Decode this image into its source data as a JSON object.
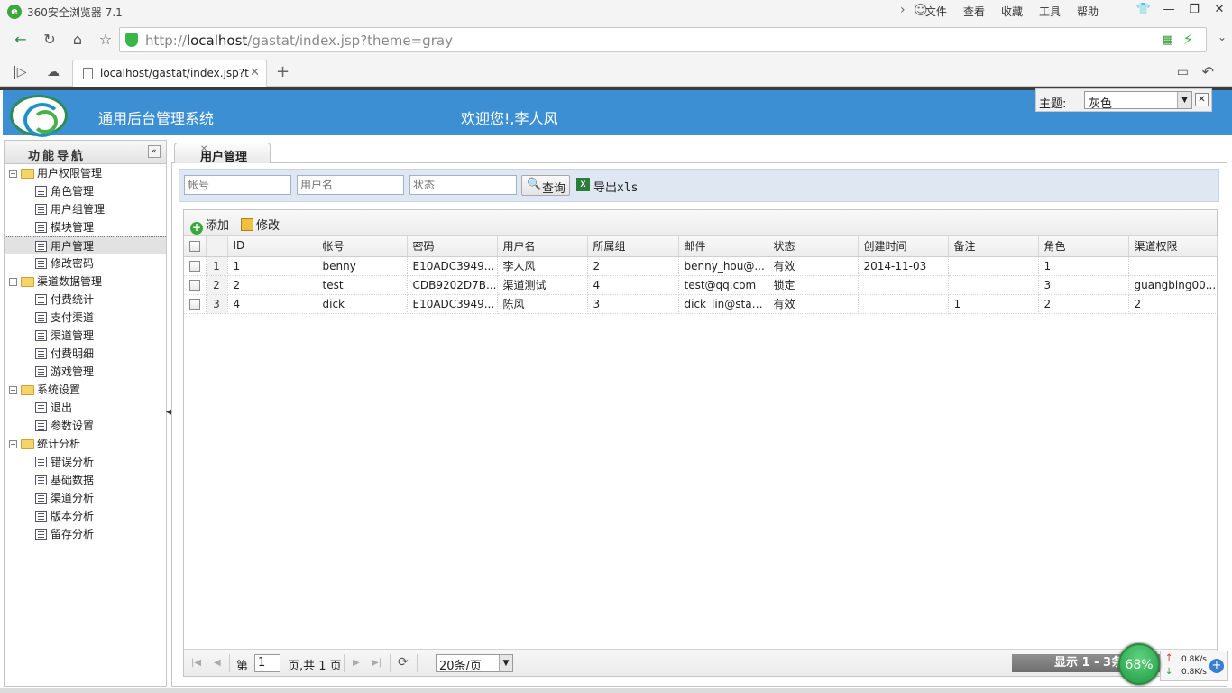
{
  "browser": {
    "app_title": "360安全浏览器 7.1",
    "menus": [
      "文件",
      "查看",
      "收藏",
      "工具",
      "帮助"
    ],
    "url_prefix": "http://",
    "url_host": "localhost",
    "url_path": "/gastat/index.jsp?theme=gray",
    "tab_title": "localhost/gastat/index.jsp?th"
  },
  "header": {
    "system_name": "通用后台管理系统",
    "welcome": "欢迎您!,李人风",
    "theme_label": "主题:",
    "theme_value": "灰色"
  },
  "sidebar": {
    "title": "功能导航",
    "groups": [
      {
        "label": "用户权限管理",
        "items": [
          "角色管理",
          "用户组管理",
          "模块管理",
          "用户管理",
          "修改密码"
        ]
      },
      {
        "label": "渠道数据管理",
        "items": [
          "付费统计",
          "支付渠道",
          "渠道管理",
          "付费明细",
          "游戏管理"
        ]
      },
      {
        "label": "系统设置",
        "items": [
          "退出",
          "参数设置"
        ]
      },
      {
        "label": "统计分析",
        "items": [
          "错误分析",
          "基础数据",
          "渠道分析",
          "版本分析",
          "留存分析"
        ]
      }
    ],
    "selected": "用户管理"
  },
  "main": {
    "tab_label": "用户管理",
    "search": {
      "account_placeholder": "帐号",
      "username_placeholder": "用户名",
      "status_placeholder": "状态",
      "query_label": "查询",
      "export_label": "导出xls"
    },
    "toolbar": {
      "add_label": "添加",
      "edit_label": "修改"
    },
    "columns": [
      "ID",
      "帐号",
      "密码",
      "用户名",
      "所属组",
      "邮件",
      "状态",
      "创建时间",
      "备注",
      "角色",
      "渠道权限"
    ],
    "rows": [
      {
        "n": "1",
        "cells": [
          "1",
          "benny",
          "E10ADC3949...",
          "李人风",
          "2",
          "benny_hou@...",
          "有效",
          "2014-11-03",
          "",
          "1",
          ""
        ]
      },
      {
        "n": "2",
        "cells": [
          "2",
          "test",
          "CDB9202D7B...",
          "渠道测试",
          "4",
          "test@qq.com",
          "锁定",
          "",
          "",
          "3",
          "guangbing00..."
        ]
      },
      {
        "n": "3",
        "cells": [
          "4",
          "dick",
          "E10ADC3949...",
          "陈风",
          "3",
          "dick_lin@staff...",
          "有效",
          "",
          "1",
          "2",
          "2"
        ]
      }
    ],
    "pager": {
      "page_prefix": "第",
      "page_value": "1",
      "page_suffix": "页,共 1 页",
      "page_size": "20条/页",
      "info": "显示 1 - 3条"
    }
  },
  "widget": {
    "percent": "68%",
    "up_speed": "0.8K/s",
    "down_speed": "0.8K/s"
  }
}
